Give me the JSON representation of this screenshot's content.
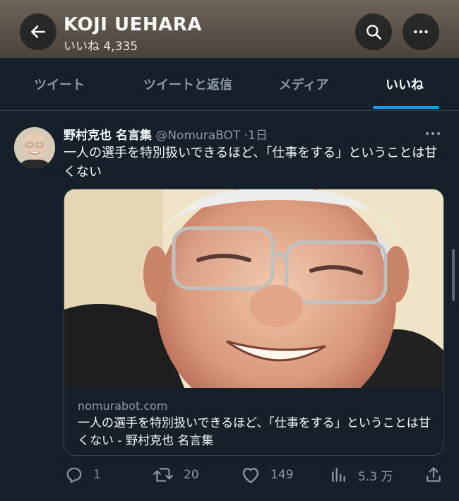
{
  "header": {
    "title": "KOJI  UEHARA",
    "subtitle": "いいね 4,335",
    "back_icon": "arrow-left-icon",
    "search_icon": "search-icon",
    "more_icon": "more-horizontal-icon"
  },
  "tabs": [
    {
      "label": "ツイート"
    },
    {
      "label": "ツイートと返信"
    },
    {
      "label": "メディア"
    },
    {
      "label": "いいね"
    }
  ],
  "active_tab": "いいね",
  "tweet": {
    "name": "野村克也 名言集",
    "handle": "@NomuraBOT",
    "dot": "·",
    "time": "1日",
    "text": "一人の選手を特別扱いできるほど、「仕事をする」ということは甘くない",
    "card": {
      "domain": "nomurabot.com",
      "title": "一人の選手を特別扱いできるほど、「仕事をする」ということは甘くない - 野村克也 名言集"
    },
    "actions": {
      "reply_count": "1",
      "retweet_count": "20",
      "like_count": "149",
      "view_count": "5.3 万"
    }
  },
  "colors": {
    "background": "#15202b",
    "accent": "#1d9bf0",
    "secondary_text": "#8b98a5",
    "border": "#38444d"
  }
}
